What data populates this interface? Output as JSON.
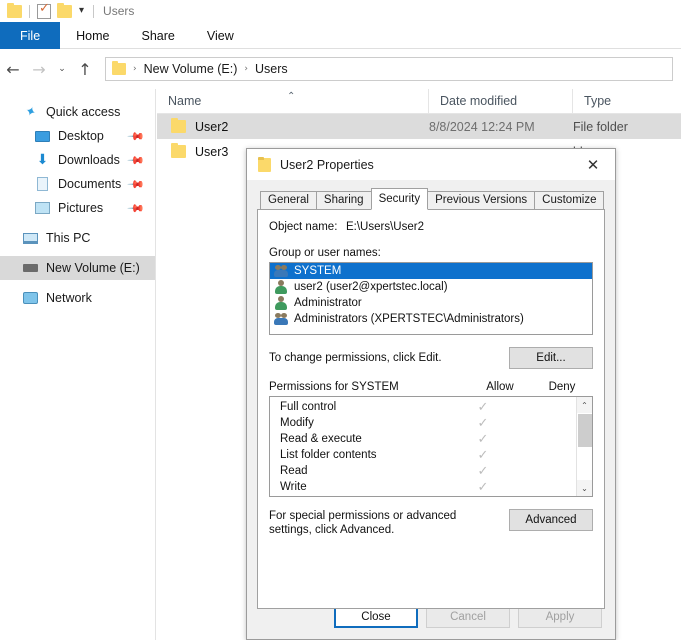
{
  "window": {
    "quick_access_title": "Users",
    "qa_icons": [
      "folder-icon",
      "properties-icon",
      "new-folder-icon",
      "customize-dropdown-icon"
    ],
    "ribbon_tabs": [
      {
        "label": "File",
        "active": true
      },
      {
        "label": "Home",
        "active": false
      },
      {
        "label": "Share",
        "active": false
      },
      {
        "label": "View",
        "active": false
      }
    ],
    "nav": {
      "back_icon": "back-arrow-icon",
      "forward_icon": "forward-arrow-icon",
      "recent_icon": "recent-locations-chevron-icon",
      "up_icon": "up-arrow-icon",
      "breadcrumbs": [
        "New Volume (E:)",
        "Users"
      ],
      "separator": "›"
    }
  },
  "sidebar": {
    "items": [
      {
        "label": "Quick access",
        "icon": "star-pin-icon",
        "child": false,
        "pinned": false,
        "selected": false
      },
      {
        "label": "Desktop",
        "icon": "desktop-icon",
        "child": true,
        "pinned": true,
        "selected": false
      },
      {
        "label": "Downloads",
        "icon": "downloads-icon",
        "child": true,
        "pinned": true,
        "selected": false
      },
      {
        "label": "Documents",
        "icon": "documents-icon",
        "child": true,
        "pinned": true,
        "selected": false
      },
      {
        "label": "Pictures",
        "icon": "pictures-icon",
        "child": true,
        "pinned": true,
        "selected": false
      },
      {
        "label": "This PC",
        "icon": "this-pc-icon",
        "child": false,
        "pinned": false,
        "selected": false
      },
      {
        "label": "New Volume (E:)",
        "icon": "drive-icon",
        "child": false,
        "pinned": false,
        "selected": true
      },
      {
        "label": "Network",
        "icon": "network-icon",
        "child": false,
        "pinned": false,
        "selected": false
      }
    ]
  },
  "filelist": {
    "columns": [
      "Name",
      "Date modified",
      "Type"
    ],
    "sort_caret": "⌃",
    "rows": [
      {
        "name": "User2",
        "date": "8/8/2024 12:24 PM",
        "type": "File folder",
        "selected": true
      },
      {
        "name": "User3",
        "date": "",
        "type": "lder",
        "selected": false
      }
    ]
  },
  "dialog": {
    "title": "User2 Properties",
    "close_label": "✕",
    "tabs": [
      {
        "label": "General",
        "active": false
      },
      {
        "label": "Sharing",
        "active": false
      },
      {
        "label": "Security",
        "active": true
      },
      {
        "label": "Previous Versions",
        "active": false
      },
      {
        "label": "Customize",
        "active": false
      }
    ],
    "object_name_label": "Object name:",
    "object_name_value": "E:\\Users\\User2",
    "group_label": "Group or user names:",
    "groups": [
      {
        "name": "SYSTEM",
        "icon": "group-icon",
        "selected": true
      },
      {
        "name": "user2 (user2@xpertstec.local)",
        "icon": "user-icon",
        "selected": false
      },
      {
        "name": "Administrator",
        "icon": "user-icon",
        "selected": false
      },
      {
        "name": "Administrators (XPERTSTEC\\Administrators)",
        "icon": "group-icon",
        "selected": false
      }
    ],
    "edit_hint": "To change permissions, click Edit.",
    "edit_button": "Edit...",
    "permissions_header": {
      "title": "Permissions for SYSTEM",
      "allow": "Allow",
      "deny": "Deny"
    },
    "permissions": [
      {
        "name": "Full control",
        "allow": "✓",
        "deny": ""
      },
      {
        "name": "Modify",
        "allow": "✓",
        "deny": ""
      },
      {
        "name": "Read & execute",
        "allow": "✓",
        "deny": ""
      },
      {
        "name": "List folder contents",
        "allow": "✓",
        "deny": ""
      },
      {
        "name": "Read",
        "allow": "✓",
        "deny": ""
      },
      {
        "name": "Write",
        "allow": "✓",
        "deny": ""
      }
    ],
    "scroll_up": "⌃",
    "scroll_down": "⌄",
    "advanced_text": "For special permissions or advanced settings, click Advanced.",
    "advanced_button": "Advanced",
    "footer": {
      "close": "Close",
      "cancel": "Cancel",
      "apply": "Apply"
    }
  },
  "colors": {
    "accent": "#0f6cbd",
    "selection": "#0e71cd",
    "folder": "#fbd96a",
    "row_selected": "#dcdcdc"
  }
}
